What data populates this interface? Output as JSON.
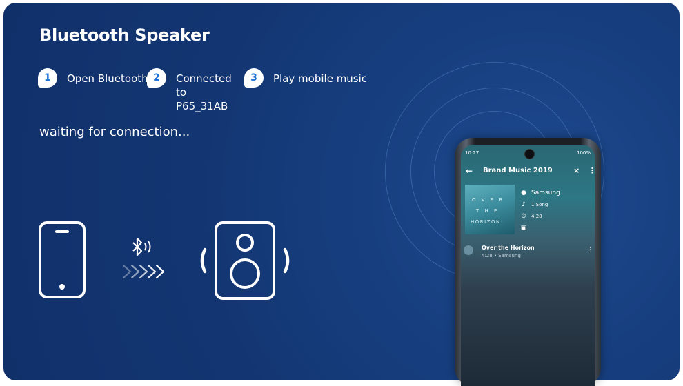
{
  "page": {
    "title": "Bluetooth Speaker",
    "waiting_text": "waiting for connection..."
  },
  "steps": [
    {
      "num": "1",
      "label": "Open Bluetooth"
    },
    {
      "num": "2",
      "label": "Connected to\nP65_31AB"
    },
    {
      "num": "3",
      "label": "Play mobile music"
    }
  ],
  "icons": {
    "phone": "smartphone-icon",
    "bluetooth": "bluetooth-wave-icon",
    "arrows": "chevron-arrows-icon",
    "speaker": "speaker-icon"
  },
  "phone_screen": {
    "status_time": "10:27",
    "status_right": "100%",
    "app_title": "Brand Music 2019",
    "album_art_lines": [
      "O V E R",
      "T H E",
      "HORIZON"
    ],
    "artist": "Samsung",
    "song_count": "1 Song",
    "duration": "4:28",
    "track_title": "Over the Horizon",
    "track_sub": "4:28 • Samsung"
  },
  "colors": {
    "panel_bg": "#143670",
    "step_badge_text": "#1e73d6",
    "text": "#ffffff"
  }
}
